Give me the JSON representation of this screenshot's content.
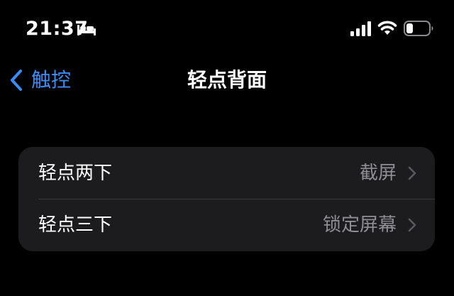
{
  "status_bar": {
    "time": "21:37",
    "sleep_icon": "bed-icon",
    "signal_icon": "cellular-signal-icon",
    "wifi_icon": "wifi-icon",
    "battery_icon": "battery-icon",
    "battery_level": 0.3
  },
  "nav": {
    "back_label": "触控",
    "title": "轻点背面"
  },
  "rows": [
    {
      "label": "轻点两下",
      "value": "截屏"
    },
    {
      "label": "轻点三下",
      "value": "锁定屏幕"
    }
  ],
  "colors": {
    "background": "#000000",
    "group_background": "#1c1c1e",
    "accent": "#3a8cf6",
    "secondary_text": "#8e8e93",
    "separator": "#38383a",
    "chevron": "#5a5a5e"
  }
}
